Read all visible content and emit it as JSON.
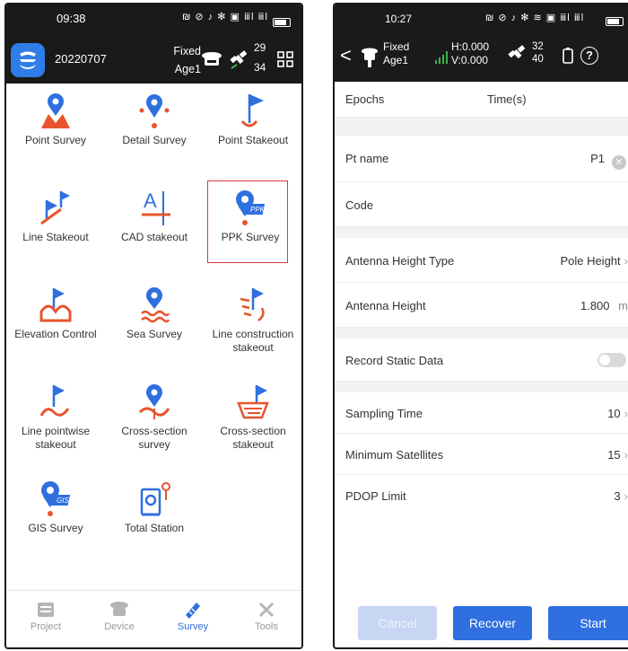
{
  "left": {
    "statusbar": {
      "time": "09:38",
      "icons": "₪ ⊘ ♪ ✻ ▣ ⅲl ⅲl"
    },
    "header": {
      "project": "20220707",
      "solution": "Fixed",
      "age": "Age1",
      "sats_top": "29",
      "sats_bottom": "34"
    },
    "grid": [
      {
        "label": "Point Survey"
      },
      {
        "label": "Detail Survey"
      },
      {
        "label": "Point Stakeout"
      },
      {
        "label": "Line Stakeout"
      },
      {
        "label": "CAD stakeout"
      },
      {
        "label": "PPK Survey"
      },
      {
        "label": "Elevation Control"
      },
      {
        "label": "Sea Survey"
      },
      {
        "label": "Line construction stakeout"
      },
      {
        "label": "Line pointwise stakeout"
      },
      {
        "label": "Cross-section survey"
      },
      {
        "label": "Cross-section stakeout"
      },
      {
        "label": "GIS Survey"
      },
      {
        "label": "Total Station"
      }
    ],
    "nav": [
      {
        "label": "Project"
      },
      {
        "label": "Device"
      },
      {
        "label": "Survey"
      },
      {
        "label": "Tools"
      }
    ]
  },
  "right": {
    "statusbar": {
      "time": "10:27",
      "icons": "₪ ⊘ ♪ ✻ ≋ ▣ ⅲl ⅲl"
    },
    "header": {
      "back": "<",
      "solution": "Fixed",
      "age": "Age1",
      "h": "H:0.000",
      "v": "V:0.000",
      "sats_top": "32",
      "sats_bottom": "40",
      "help": "?"
    },
    "form": {
      "epochs_label": "Epochs",
      "time_label": "Time(s)",
      "pt_name_label": "Pt name",
      "pt_name_value": "P1",
      "code_label": "Code",
      "antenna_type_label": "Antenna Height Type",
      "antenna_type_value": "Pole Height",
      "antenna_height_label": "Antenna Height",
      "antenna_height_value": "1.800",
      "antenna_height_unit": "m",
      "static_label": "Record Static Data",
      "sampling_label": "Sampling Time",
      "sampling_value": "10",
      "minsat_label": "Minimum Satellites",
      "minsat_value": "15",
      "pdop_label": "PDOP Limit",
      "pdop_value": "3"
    },
    "buttons": {
      "cancel": "Cancel",
      "recover": "Recover",
      "start": "Start"
    }
  },
  "colors": {
    "accent_blue": "#2f6fe0",
    "accent_orange": "#e8542c",
    "selection_red": "#d43c3c"
  }
}
